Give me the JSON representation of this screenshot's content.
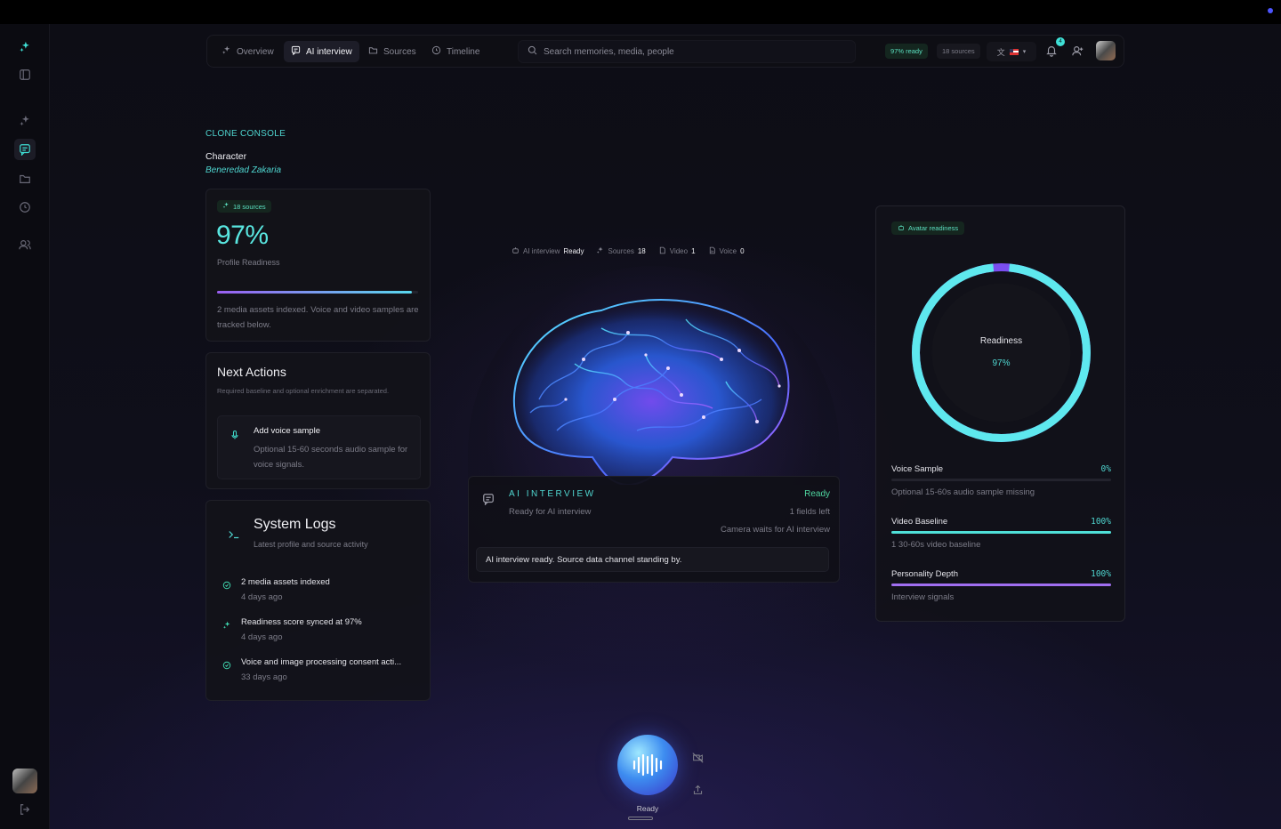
{
  "nav": {
    "tabs": [
      {
        "label": "Overview",
        "icon": "sparkles-icon"
      },
      {
        "label": "AI interview",
        "icon": "chat-icon"
      },
      {
        "label": "Sources",
        "icon": "folder-icon"
      },
      {
        "label": "Timeline",
        "icon": "clock-icon"
      }
    ],
    "active_tab": "AI interview",
    "search_placeholder": "Search memories, media, people",
    "ready_pill": "97% ready",
    "sources_pill": "18 sources",
    "notifications_count": "4"
  },
  "header": {
    "section": "CLONE CONSOLE",
    "character_label": "Character",
    "character_name": "Beneredad Zakaria"
  },
  "profile": {
    "sources_chip": "18 sources",
    "readiness": "97%",
    "readiness_value": 0.97,
    "readiness_label": "Profile Readiness",
    "description": "2 media assets indexed. Voice and video samples are tracked below."
  },
  "next_actions": {
    "title": "Next Actions",
    "subtitle": "Required baseline and optional enrichment are separated.",
    "item": {
      "title": "Add voice sample",
      "description": "Optional 15-60 seconds audio sample for voice signals."
    }
  },
  "logs": {
    "title": "System Logs",
    "subtitle": "Latest profile and source activity",
    "items": [
      {
        "text": "2 media assets indexed",
        "time": "4 days ago",
        "icon": "check-circle-icon"
      },
      {
        "text": "Readiness score synced at 97%",
        "time": "4 days ago",
        "icon": "sparkles-icon"
      },
      {
        "text": "Voice and image processing consent acti...",
        "time": "33 days ago",
        "icon": "check-circle-icon"
      }
    ]
  },
  "stats": [
    {
      "label": "AI interview",
      "value": "Ready",
      "icon": "robot-icon"
    },
    {
      "label": "Sources",
      "value": "18",
      "icon": "sparkles-icon"
    },
    {
      "label": "Video",
      "value": "1",
      "icon": "file-icon"
    },
    {
      "label": "Voice",
      "value": "0",
      "icon": "file-audio-icon"
    }
  ],
  "interview": {
    "title": "AI INTERVIEW",
    "subtitle": "Ready for AI interview",
    "status": "Ready",
    "fields_left": "1 fields left",
    "camera_note": "Camera waits for AI interview",
    "message": "AI interview ready. Source data channel standing by."
  },
  "avatar_panel": {
    "chip": "Avatar readiness",
    "ring_label": "Readiness",
    "ring_value": "97%",
    "ring_fraction": 0.97,
    "metrics": [
      {
        "name": "Voice Sample",
        "value": "0%",
        "fraction": 0.0,
        "description": "Optional 15-60s audio sample missing",
        "color": "#4fd6d0"
      },
      {
        "name": "Video Baseline",
        "value": "100%",
        "fraction": 1.0,
        "description": "1 30-60s video baseline",
        "color": "#4fe0d8"
      },
      {
        "name": "Personality Depth",
        "value": "100%",
        "fraction": 1.0,
        "description": "Interview signals",
        "color": "#a06ef0"
      }
    ]
  },
  "voice_control": {
    "status": "Ready"
  },
  "colors": {
    "accent": "#4fd6d0",
    "purple": "#a06ef0",
    "background": "#0c0c14"
  }
}
